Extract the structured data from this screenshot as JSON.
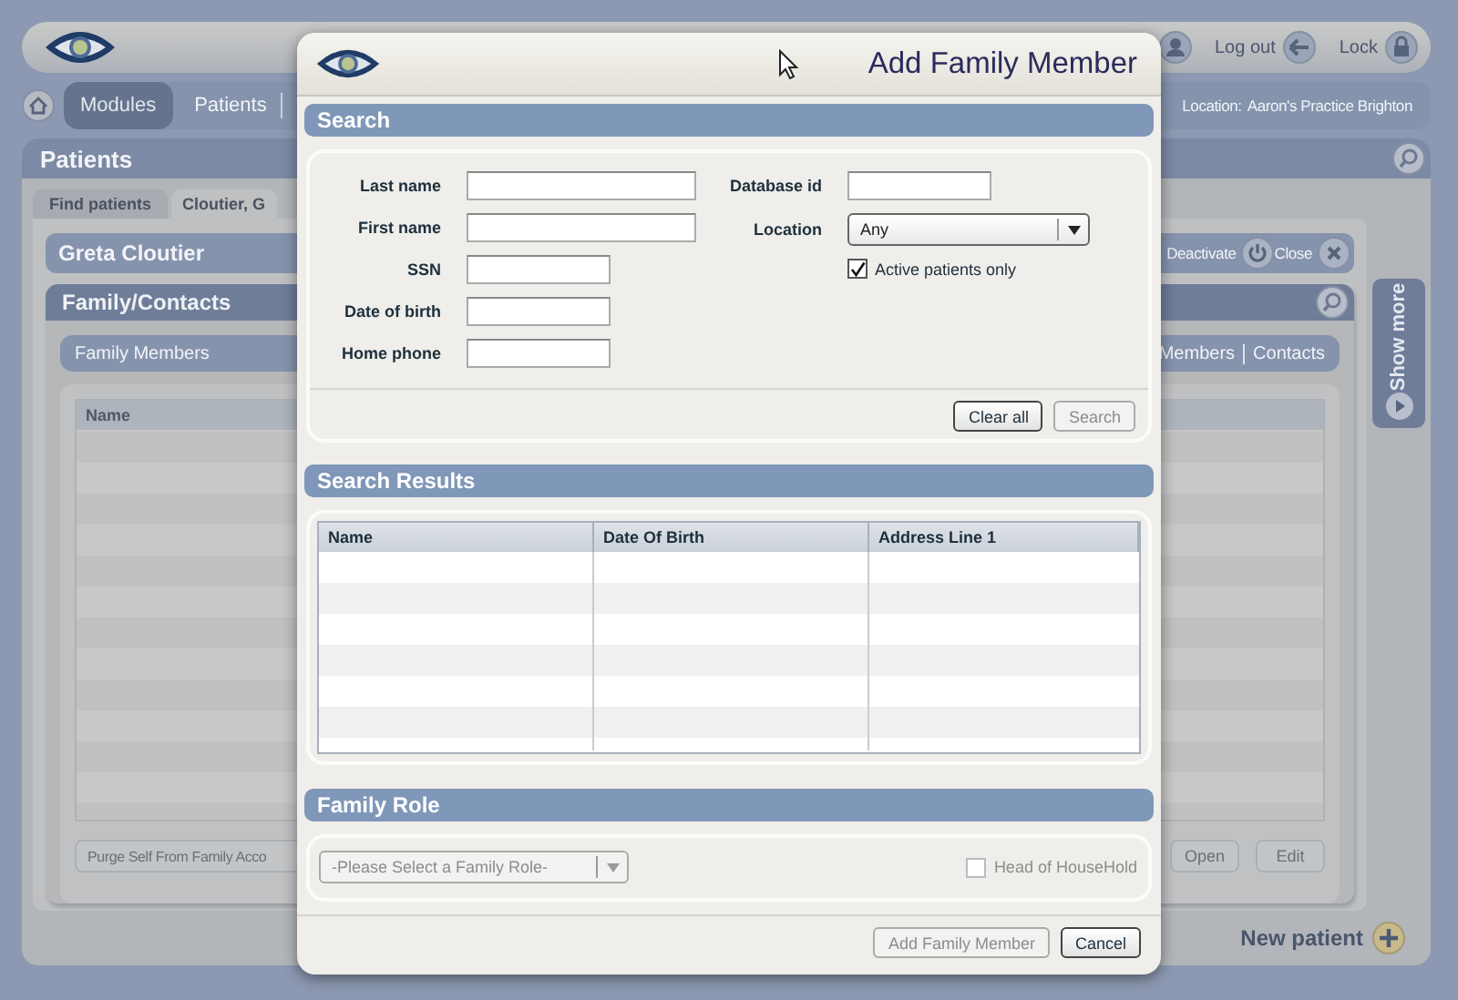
{
  "background": {
    "top_actions": [
      {
        "label": "Log out",
        "kind": "logout"
      },
      {
        "label": "Lock",
        "kind": "lock"
      }
    ],
    "nav": {
      "items": [
        {
          "label": "Modules",
          "selected": true
        },
        {
          "label": "Patients",
          "selected": false
        }
      ],
      "location_label": "Location:",
      "location": "Aaron's Practice Brighton"
    },
    "panel_title": "Patients",
    "tabs": [
      {
        "label": "Find patients",
        "selected": false
      },
      {
        "label": "Cloutier, G",
        "selected": true
      }
    ],
    "patient_name": "Greta Cloutier",
    "patient_actions": [
      {
        "label": "Deactivate",
        "kind": "power"
      },
      {
        "label": "Close",
        "kind": "close"
      }
    ],
    "section_title": "Family/Contacts",
    "subnav": {
      "left": "Family Members",
      "right": [
        "Members",
        "Contacts"
      ]
    },
    "table": {
      "columns": [
        "Name"
      ]
    },
    "buttons": [
      {
        "label": "Purge Self From Family Acco"
      },
      {
        "label": "Open"
      },
      {
        "label": "Edit"
      }
    ],
    "show_more": "Show more",
    "new_patient": "New patient"
  },
  "dialog": {
    "title": "Add Family Member",
    "search": {
      "title": "Search",
      "left_fields": [
        {
          "label": "Last name",
          "kind": "long"
        },
        {
          "label": "First name",
          "kind": "long"
        },
        {
          "label": "SSN",
          "kind": "short"
        },
        {
          "label": "Date of birth",
          "kind": "short"
        },
        {
          "label": "Home phone",
          "kind": "short"
        }
      ],
      "database_id": {
        "label": "Database id"
      },
      "location": {
        "label": "Location",
        "value": "Any"
      },
      "active_only": {
        "label": "Active patients only",
        "checked": true
      },
      "buttons": [
        {
          "label": "Clear all",
          "disabled": false
        },
        {
          "label": "Search",
          "disabled": true
        }
      ]
    },
    "results": {
      "title": "Search Results",
      "columns": [
        "Name",
        "Date Of Birth",
        "Address Line 1"
      ]
    },
    "family_role": {
      "title": "Family Role",
      "select": {
        "placeholder": "-Please Select a Family Role-",
        "disabled": true
      },
      "head_of_household": {
        "label": "Head of HouseHold",
        "checked": false,
        "disabled": true
      }
    },
    "buttons": [
      {
        "label": "Add Family Member",
        "disabled": true
      },
      {
        "label": "Cancel",
        "disabled": false
      }
    ]
  }
}
